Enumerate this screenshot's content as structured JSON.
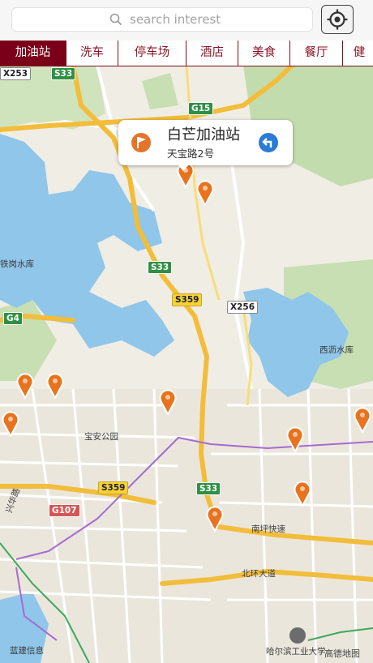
{
  "search": {
    "placeholder": "search interest"
  },
  "categories": [
    "加油站",
    "洗车",
    "停车场",
    "酒店",
    "美食",
    "餐厅",
    "健"
  ],
  "active_category": 0,
  "callout": {
    "title": "白芒加油站",
    "address": "天宝路2号"
  },
  "map_labels": {
    "reservoir_west": "铁岗水库",
    "reservoir_east": "西沥水库",
    "park": "宝安公园",
    "expressway_nanping": "南坪快速",
    "avenue_beihuan": "北环大道",
    "road_xixiang": "兴华路",
    "info": "蓝建信息",
    "harbin": "哈尔滨工业大学",
    "brand": "高德地图"
  },
  "road_shields": {
    "x253": "X253",
    "s33_top": "S33",
    "g15": "G15",
    "s33_mid": "S33",
    "s359_mid": "S359",
    "x256": "X256",
    "g4": "G4",
    "s359_low": "S359",
    "s33_low": "S33",
    "g107": "G107"
  },
  "colors": {
    "accent": "#7a0019",
    "pin": "#e8731c",
    "water": "#88c2e8",
    "green": "#bcd9a8",
    "road": "#f6c343"
  }
}
